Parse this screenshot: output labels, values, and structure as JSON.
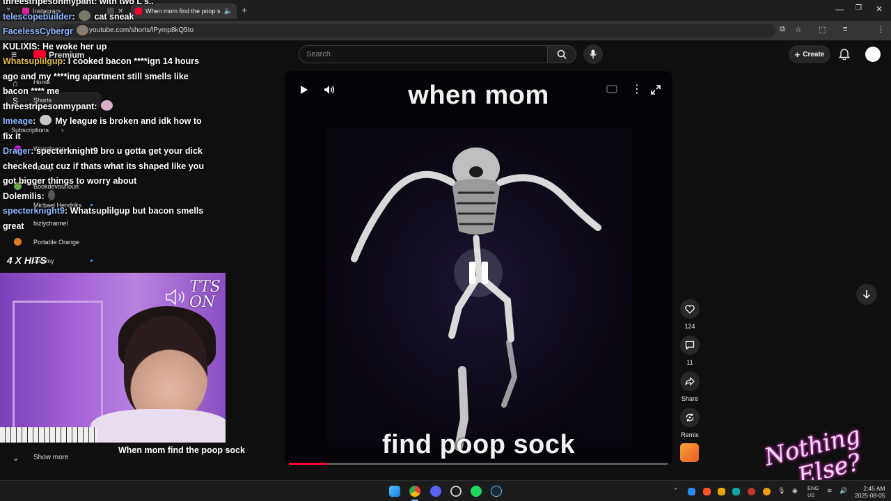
{
  "browser": {
    "tabs": [
      {
        "label": "Instagram",
        "favicon_color": "#d6249f"
      },
      {
        "label": "",
        "favicon_color": "#4a4a4a"
      },
      {
        "label": "When mom find the poop s",
        "favicon_color": "#ff0033"
      }
    ],
    "new_tab_label": "+",
    "url": "youtube.com/shorts/lPymp8kQ5to",
    "window_controls": [
      "—",
      "❐",
      "✕"
    ]
  },
  "youtube": {
    "logo_label": "Premium",
    "search_placeholder": "Search",
    "create_label": "Create",
    "sidebar": {
      "home": "Home",
      "shorts": "Shorts",
      "subscriptions": "Subscriptions",
      "channels": [
        "Wendigoon",
        "Reality",
        "Bookdevourloun",
        "Michael Hendriks",
        "bizlychannel",
        "Portable Orange",
        "Jeremy"
      ]
    },
    "short": {
      "caption_top": "when mom",
      "caption_bottom": "find poop sock",
      "title": "When mom find the poop sock",
      "progress": 0.1,
      "show_more": "Show more"
    },
    "actions": {
      "likes": "124",
      "comments": "11",
      "share": "Share",
      "remix": "Remix"
    }
  },
  "chat": {
    "messages": [
      {
        "user": "",
        "user_color": "#ffffff",
        "text": "threestripesonmypant: with two L's.."
      },
      {
        "user": "telescopebuilder",
        "user_color": "#8fb7ff",
        "text": "cat sneak"
      },
      {
        "user": "FacelessCybergr",
        "user_color": "#8fb7ff",
        "text": ""
      },
      {
        "user": "",
        "user_color": "#ffffff",
        "text": "KULIXIS: He woke her up"
      },
      {
        "user": "Whatsuplilgup",
        "user_color": "#e0c04a",
        "text": "I cooked bacon ****ign 14 hours ago and my ****ing apartment still smells like bacon **** me"
      },
      {
        "user": "",
        "user_color": "#ffffff",
        "text": "threestripesonmypant:"
      },
      {
        "user": "Imeage",
        "user_color": "#8fb7ff",
        "text": "My league is broken and idk how to fix it"
      },
      {
        "user": "Drager",
        "user_color": "#8fb7ff",
        "text": "specterknight9 bro u gotta get your dick checked out cuz if thats what its shaped like you got bigger things to worry about"
      },
      {
        "user": "",
        "user_color": "#ffffff",
        "text": "Dolemilis:"
      },
      {
        "user": "specterknight9",
        "user_color": "#8fb7ff",
        "text": "Whatsuplilgup but bacon smells great"
      }
    ],
    "hits_label": "4 X HITS"
  },
  "overlay": {
    "tts_line1": "TTS",
    "tts_line2": "ON",
    "brand_line1": "Nothing",
    "brand_line2": "Else?"
  },
  "taskbar": {
    "lang_top": "ENG",
    "lang_bottom": "US",
    "time": "2:45 AM",
    "date": "2025-08-05"
  }
}
